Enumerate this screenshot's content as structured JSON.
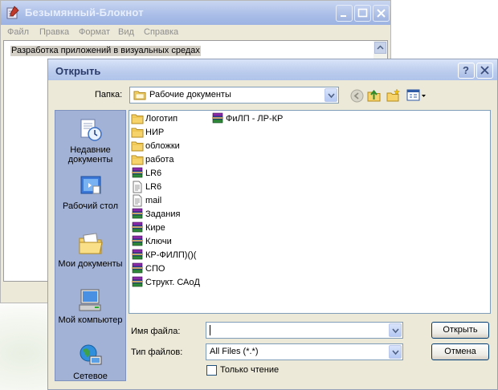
{
  "notepad": {
    "title": "Безымянный-Блокнот",
    "menu": [
      "Файл",
      "Правка",
      "Формат",
      "Вид",
      "Справка"
    ],
    "text": "Разработка приложений в визуальных средах"
  },
  "dialog": {
    "title": "Открыть",
    "help_label": "?",
    "folder_label": "Папка:",
    "folder_value": "Рабочие документы",
    "places": [
      "Недавние документы",
      "Рабочий стол",
      "Мои документы",
      "Мой компьютер",
      "Сетевое"
    ],
    "files": [
      {
        "name": "Логотип",
        "icon": "folder-icon"
      },
      {
        "name": "НИР",
        "icon": "folder-icon"
      },
      {
        "name": "обложки",
        "icon": "folder-icon"
      },
      {
        "name": "работа",
        "icon": "folder-icon"
      },
      {
        "name": "LR6",
        "icon": "winrar-icon"
      },
      {
        "name": "LR6",
        "icon": "text-file-icon"
      },
      {
        "name": "mail",
        "icon": "text-file-icon"
      },
      {
        "name": "Задания",
        "icon": "winrar-icon"
      },
      {
        "name": "Кире",
        "icon": "winrar-icon"
      },
      {
        "name": "Ключи",
        "icon": "winrar-icon"
      },
      {
        "name": "КР-ФИЛП)()(",
        "icon": "winrar-icon"
      },
      {
        "name": "СПО",
        "icon": "winrar-icon"
      },
      {
        "name": "Структ. САоД",
        "icon": "winrar-icon"
      },
      {
        "name": "ФиЛП - ЛР-КР",
        "icon": "winrar-icon"
      }
    ],
    "filename_label": "Имя файла:",
    "filename_value": "",
    "filetype_label": "Тип файлов:",
    "filetype_value": "All Files (*.*)",
    "open_button": "Открыть",
    "cancel_button": "Отмена",
    "readonly_label": "Только чтение"
  }
}
